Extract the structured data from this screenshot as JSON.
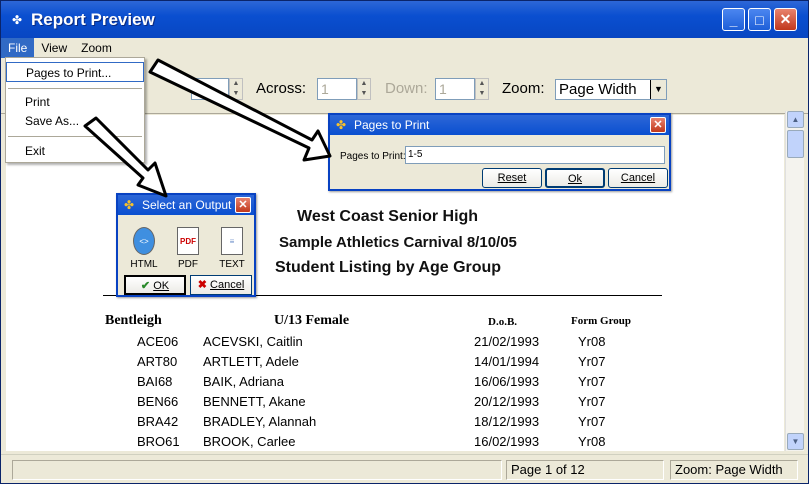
{
  "window": {
    "title": "Report Preview",
    "minimize": "_",
    "maximize": "□",
    "close": "✕",
    "icon": "app-icon"
  },
  "menubar": {
    "file": "File",
    "view": "View",
    "zoom": "Zoom"
  },
  "file_menu": {
    "pages_to_print": "Pages to Print...",
    "print": "Print",
    "save_as": "Save As...",
    "exit": "Exit"
  },
  "toolbar": {
    "across_label": "Across:",
    "across_value": "1",
    "down_label": "Down:",
    "down_value": "1",
    "zoom_label": "Zoom:",
    "zoom_value": "Page Width"
  },
  "pages_dialog": {
    "title": "Pages to Print",
    "field_label": "Pages to Print:",
    "field_value": "1-5",
    "reset": "Reset",
    "ok": "Ok",
    "cancel": "Cancel"
  },
  "output_dialog": {
    "title": "Select an Output",
    "options": [
      "HTML",
      "PDF",
      "TEXT"
    ],
    "pdf_badge": "PDF",
    "ok": "OK",
    "cancel": "Cancel"
  },
  "report": {
    "line1": "West Coast Senior High",
    "line2": "Sample Athletics Carnival  8/10/05",
    "line3": "Student Listing by Age Group",
    "house": "Bentleigh",
    "group": "U/13   Female",
    "dob_header": "D.o.B.",
    "form_header": "Form Group",
    "rows": [
      {
        "code": "ACE06",
        "name": "ACEVSKI, Caitlin",
        "dob": "21/02/1993",
        "form": "Yr08"
      },
      {
        "code": "ART80",
        "name": "ARTLETT, Adele",
        "dob": "14/01/1994",
        "form": "Yr07"
      },
      {
        "code": "BAI68",
        "name": "BAIK, Adriana",
        "dob": "16/06/1993",
        "form": "Yr07"
      },
      {
        "code": "BEN66",
        "name": "BENNETT, Akane",
        "dob": "20/12/1993",
        "form": "Yr07"
      },
      {
        "code": "BRA42",
        "name": "BRADLEY, Alannah",
        "dob": "18/12/1993",
        "form": "Yr07"
      },
      {
        "code": "BRO61",
        "name": "BROOK, Carlee",
        "dob": "16/02/1993",
        "form": "Yr08"
      }
    ]
  },
  "status": {
    "page": "Page 1 of 12",
    "zoom": "Zoom: Page Width"
  },
  "scrollbar": {
    "up_icon": "▲",
    "down_icon": "▼"
  }
}
